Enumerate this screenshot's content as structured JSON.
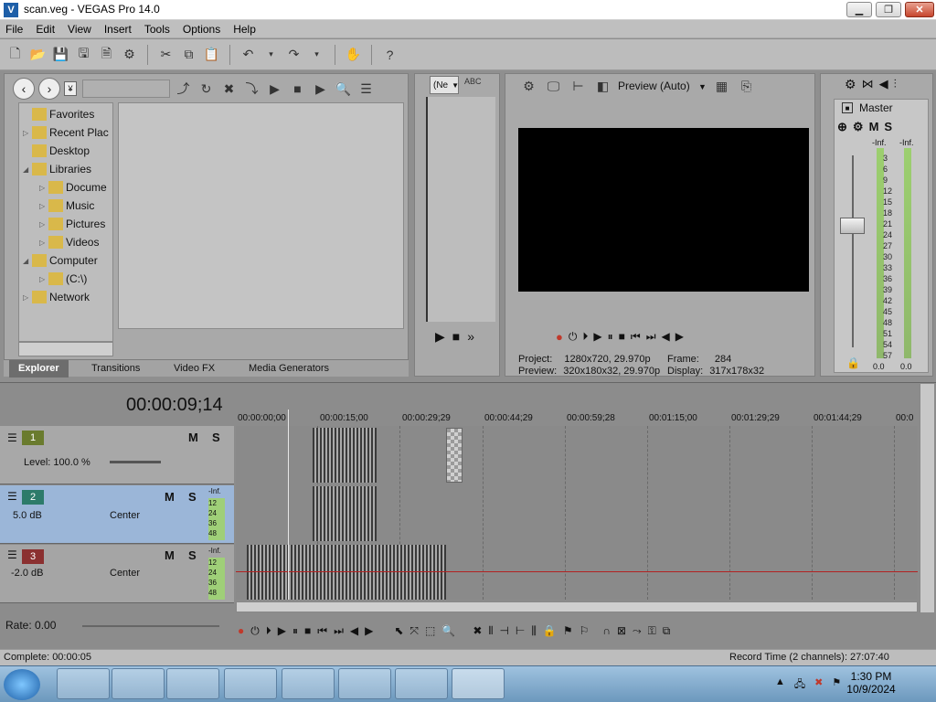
{
  "window": {
    "title": "scan.veg - VEGAS Pro 14.0",
    "icon": "vegas-icon"
  },
  "menu": [
    "File",
    "Edit",
    "View",
    "Insert",
    "Tools",
    "Options",
    "Help"
  ],
  "explorer": {
    "tree": [
      {
        "label": "Favorites",
        "icon": "star-folder-icon",
        "indent": 0,
        "expander": ""
      },
      {
        "label": "Recent Plac",
        "icon": "recent-icon",
        "indent": 0,
        "expander": "▷"
      },
      {
        "label": "Desktop",
        "icon": "desktop-icon",
        "indent": 0,
        "expander": ""
      },
      {
        "label": "Libraries",
        "icon": "library-icon",
        "indent": 0,
        "expander": "◢"
      },
      {
        "label": "Docume",
        "icon": "document-icon",
        "indent": 1,
        "expander": "▷"
      },
      {
        "label": "Music",
        "icon": "music-icon",
        "indent": 1,
        "expander": "▷"
      },
      {
        "label": "Pictures",
        "icon": "pictures-icon",
        "indent": 1,
        "expander": "▷"
      },
      {
        "label": "Videos",
        "icon": "videos-icon",
        "indent": 1,
        "expander": "▷"
      },
      {
        "label": "Computer",
        "icon": "computer-icon",
        "indent": 0,
        "expander": "◢"
      },
      {
        "label": "(C:\\)",
        "icon": "drive-icon",
        "indent": 1,
        "expander": "▷"
      },
      {
        "label": "Network",
        "icon": "network-icon",
        "indent": 0,
        "expander": "▷"
      }
    ],
    "tabs": [
      "Explorer",
      "Transitions",
      "Video FX",
      "Media Generators"
    ]
  },
  "trimmer": {
    "select": "(Ne"
  },
  "preview": {
    "mode": "Preview (Auto)",
    "project_label": "Project:",
    "project_value": "1280x720, 29.970p",
    "preview_label": "Preview:",
    "preview_value": "320x180x32, 29.970p",
    "frame_label": "Frame:",
    "frame_value": "284",
    "display_label": "Display:",
    "display_value": "317x178x32"
  },
  "mixer": {
    "master": "Master",
    "inf_left": "-Inf.",
    "inf_right": "-Inf.",
    "ticks": [
      "3",
      "6",
      "9",
      "12",
      "15",
      "18",
      "21",
      "24",
      "27",
      "30",
      "33",
      "36",
      "39",
      "42",
      "45",
      "48",
      "51",
      "54",
      "57"
    ],
    "val_left": "0.0",
    "val_right": "0.0"
  },
  "timeline": {
    "timecode": "00:00:09;14",
    "ruler": [
      "00:00:00;00",
      "00:00:15;00",
      "00:00:29;29",
      "00:00:44;29",
      "00:00:59;28",
      "00:01:15;00",
      "00:01:29;29",
      "00:01:44;29",
      "00:0"
    ],
    "tracks": [
      {
        "num": "1",
        "kind": "video",
        "level": "Level: 100.0 %"
      },
      {
        "num": "2",
        "kind": "audio",
        "vol": "5.0 dB",
        "pan": "Center",
        "inf": "-Inf.",
        "meter": [
          "12",
          "24",
          "36",
          "48"
        ]
      },
      {
        "num": "3",
        "kind": "audio",
        "vol": "-2.0 dB",
        "pan": "Center",
        "inf": "-Inf.",
        "meter": [
          "12",
          "24",
          "36",
          "48"
        ]
      }
    ],
    "rate": "Rate: 0.00"
  },
  "status": {
    "left": "Complete: 00:00:05",
    "right": "Record Time (2 channels): 27:07:40"
  },
  "taskbar": {
    "time": "1:30 PM",
    "date": "10/9/2024"
  }
}
